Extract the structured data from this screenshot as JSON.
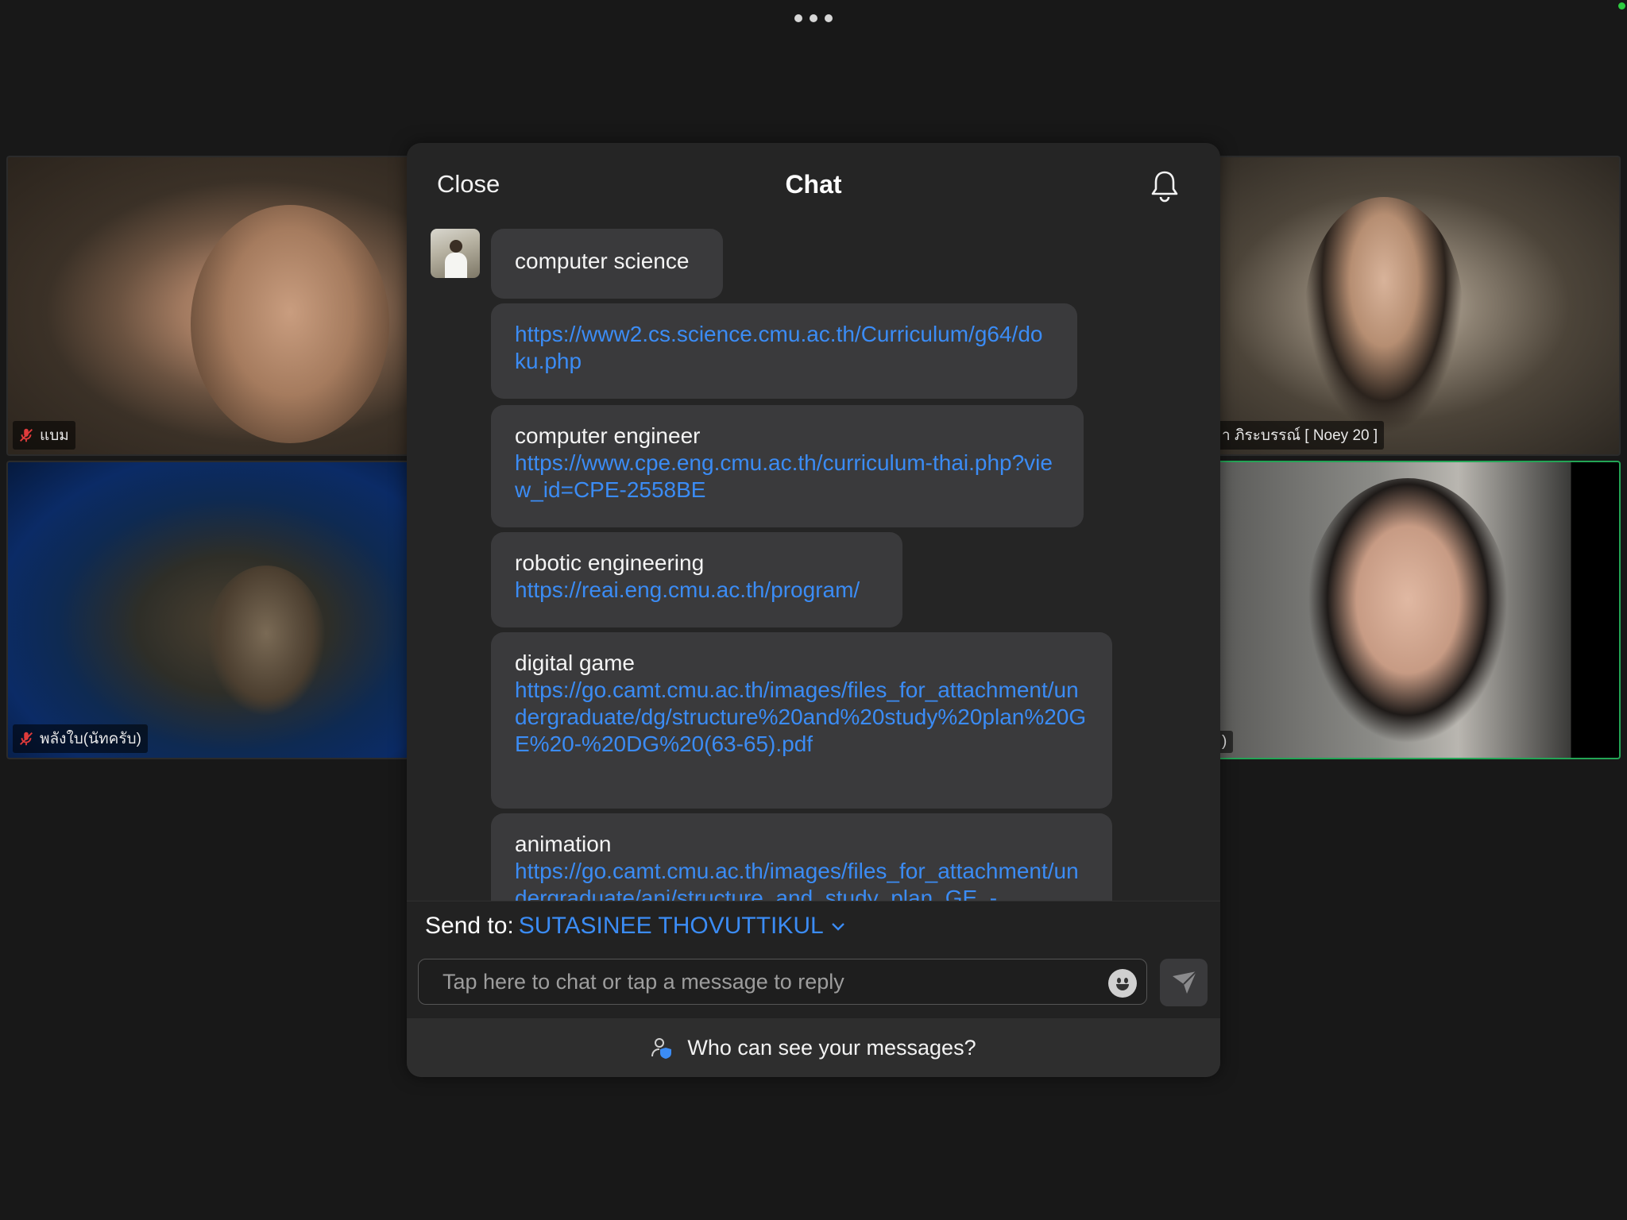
{
  "top": {
    "more_icon": "more-dots-icon"
  },
  "participants": [
    {
      "name": "แบม",
      "muted": true
    },
    {
      "name": "พลังใบ(นัทครับ)",
      "muted": true
    },
    {
      "name": "า ภิระบรรณ์ [ Noey 20 ]",
      "muted": false
    },
    {
      "name": ")",
      "muted": false,
      "active_speaker": true
    }
  ],
  "chat": {
    "close_label": "Close",
    "title": "Chat",
    "bell_icon": "bell-icon",
    "messages": [
      {
        "text": "computer science",
        "link": ""
      },
      {
        "text": "",
        "link": "https://www2.cs.science.cmu.ac.th/Curriculum/g64/doku.php"
      },
      {
        "text": "computer engineer",
        "link": "https://www.cpe.eng.cmu.ac.th/curriculum-thai.php?view_id=CPE-2558BE"
      },
      {
        "text": "robotic engineering",
        "link": "https://reai.eng.cmu.ac.th/program/"
      },
      {
        "text": "digital game",
        "link": "https://go.camt.cmu.ac.th/images/files_for_attachment/undergraduate/dg/structure%20and%20study%20plan%20GE%20-%20DG%20(63-65).pdf"
      },
      {
        "text": "animation",
        "link": "https://go.camt.cmu.ac.th/images/files_for_attachment/undergraduate/ani/structure_and_study_plan_GE_-"
      }
    ],
    "send_to_label": "Send to:",
    "recipient": "SUTASINEE THOVUTTIKUL",
    "input_placeholder": "Tap here to chat or tap a message to reply",
    "input_value": "",
    "who_can_see_label": "Who can see your messages?"
  },
  "colors": {
    "link": "#3b8cf5",
    "panel_bg": "#252525",
    "bubble_bg": "#3a3a3c",
    "active_speaker_border": "#23a455"
  }
}
